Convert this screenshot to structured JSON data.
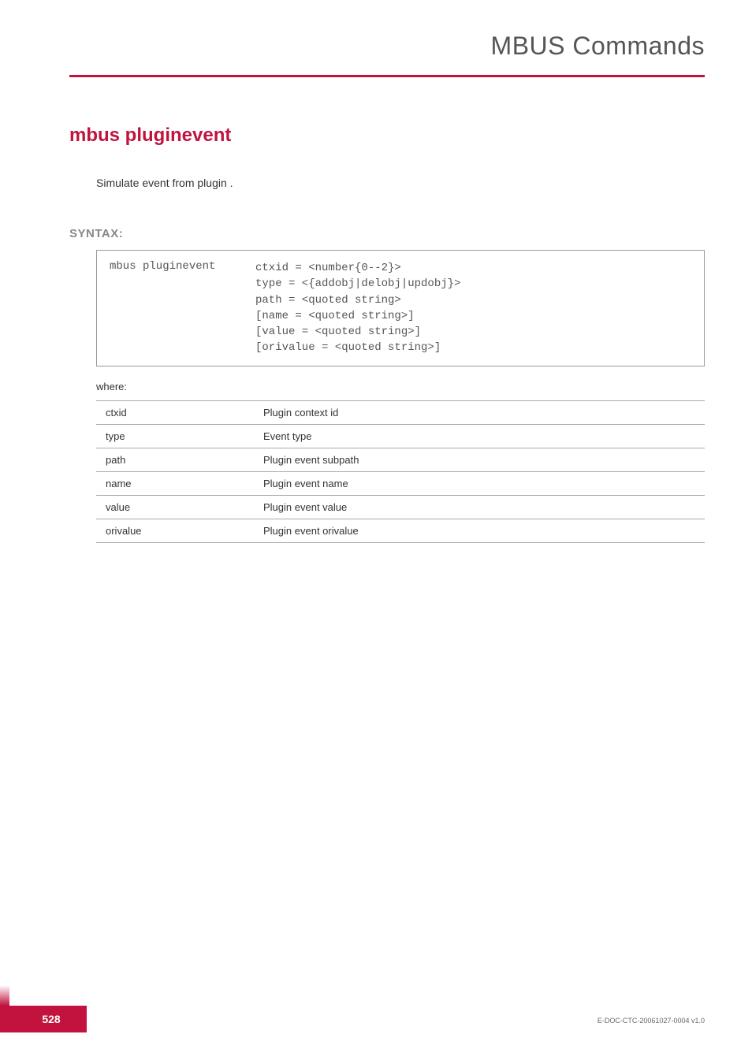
{
  "header": {
    "title": "MBUS Commands"
  },
  "command": {
    "title": "mbus pluginevent",
    "description": "Simulate event from plugin ."
  },
  "syntax": {
    "label": "SYNTAX:",
    "cmd": "mbus pluginevent",
    "args": "ctxid = <number{0--2}>\ntype = <{addobj|delobj|updobj}>\npath = <quoted string>\n[name = <quoted string>]\n[value = <quoted string>]\n[orivalue = <quoted string>]"
  },
  "where": {
    "label": "where:",
    "rows": [
      {
        "name": "ctxid",
        "desc": "Plugin context id"
      },
      {
        "name": "type",
        "desc": "Event type"
      },
      {
        "name": "path",
        "desc": "Plugin event subpath"
      },
      {
        "name": "name",
        "desc": "Plugin event name"
      },
      {
        "name": "value",
        "desc": "Plugin event value"
      },
      {
        "name": "orivalue",
        "desc": "Plugin event orivalue"
      }
    ]
  },
  "footer": {
    "page": "528",
    "docCode": "E-DOC-CTC-20061027-0004 v1.0"
  }
}
